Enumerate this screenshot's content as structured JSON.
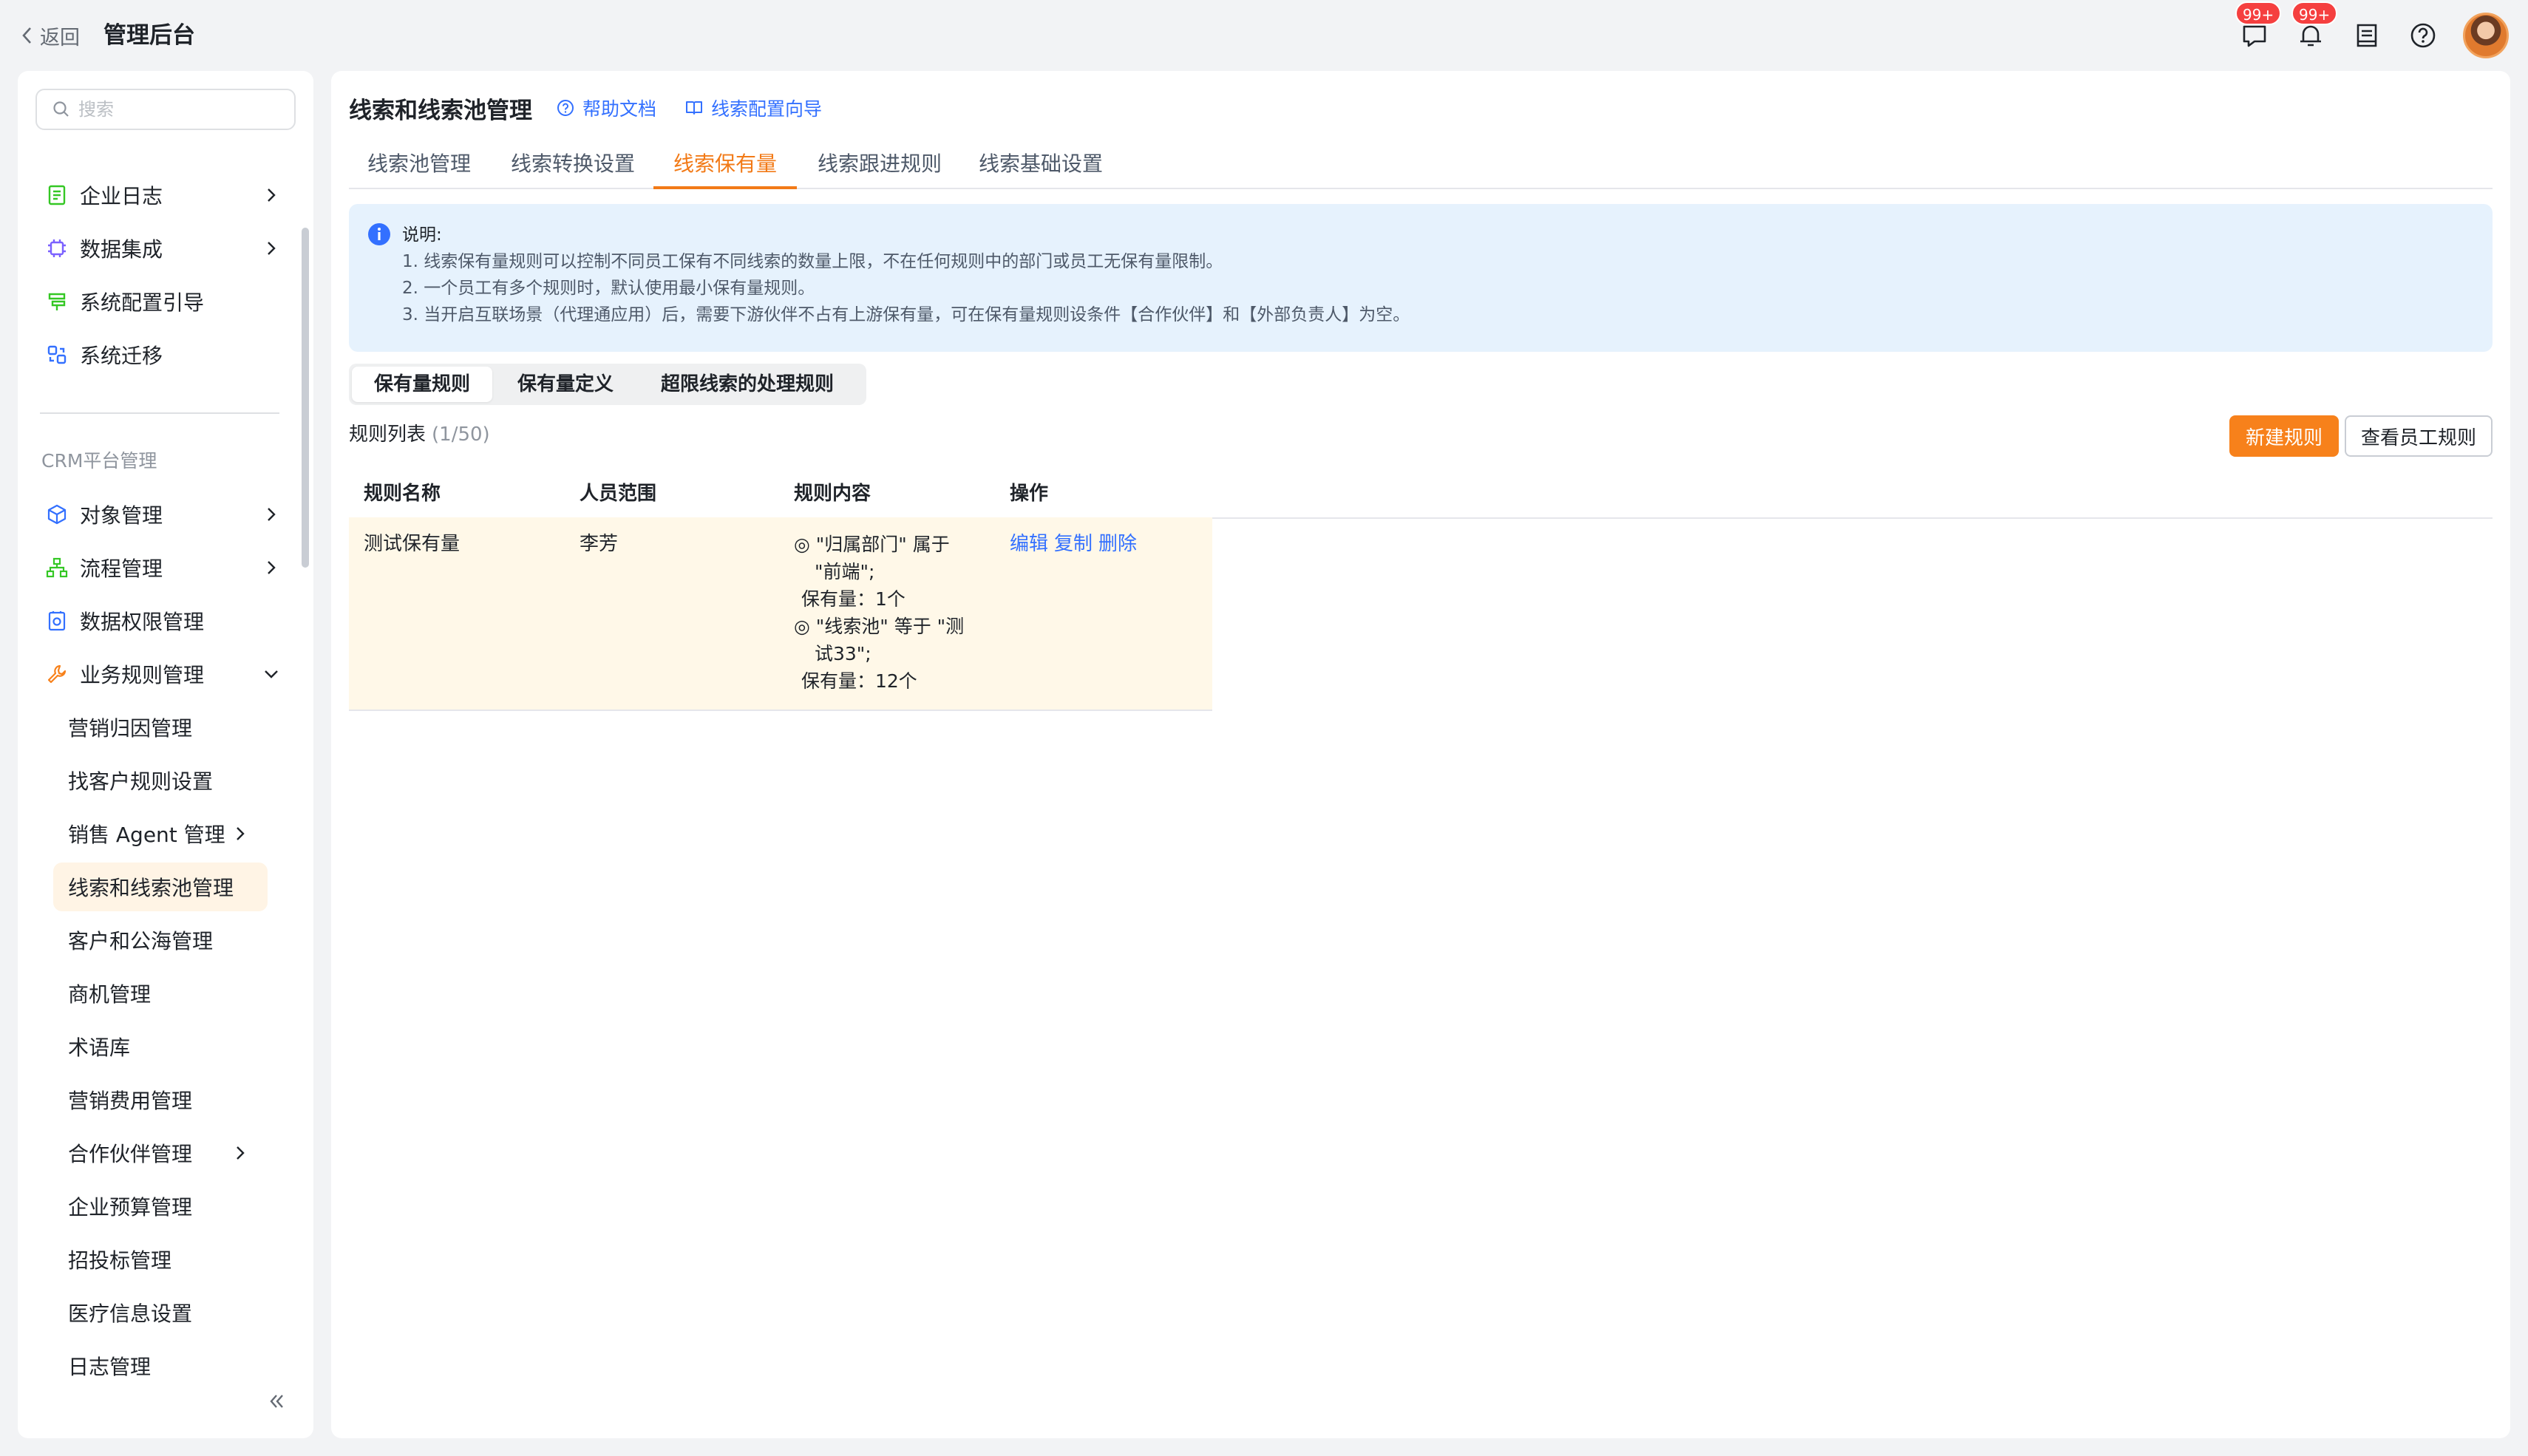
{
  "topbar": {
    "back_label": "返回",
    "app_title": "管理后台",
    "message_badge": "99+",
    "notification_badge": "99+"
  },
  "sidebar": {
    "search_placeholder": "搜索",
    "items_top": [
      {
        "label": "企业日志",
        "icon": "journal-icon",
        "has_children": true
      },
      {
        "label": "数据集成",
        "icon": "chip-icon",
        "has_children": true
      },
      {
        "label": "系统配置引导",
        "icon": "guide-icon",
        "has_children": false
      },
      {
        "label": "系统迁移",
        "icon": "migrate-icon",
        "has_children": false
      }
    ],
    "group_label": "CRM平台管理",
    "items_crm": [
      {
        "label": "对象管理",
        "icon": "cube-icon",
        "has_children": true
      },
      {
        "label": "流程管理",
        "icon": "flow-icon",
        "has_children": true
      },
      {
        "label": "数据权限管理",
        "icon": "data-permission-icon",
        "has_children": false
      },
      {
        "label": "业务规则管理",
        "icon": "wrench-icon",
        "has_children": true,
        "expanded": true
      }
    ],
    "sub_items": [
      {
        "label": "营销归因管理"
      },
      {
        "label": "找客户规则设置"
      },
      {
        "label": "销售 Agent 管理",
        "has_children": true
      },
      {
        "label": "线索和线索池管理",
        "active": true
      },
      {
        "label": "客户和公海管理"
      },
      {
        "label": "商机管理"
      },
      {
        "label": "术语库"
      },
      {
        "label": "营销费用管理"
      },
      {
        "label": "合作伙伴管理",
        "has_children": true
      },
      {
        "label": "企业预算管理"
      },
      {
        "label": "招投标管理"
      },
      {
        "label": "医疗信息设置"
      },
      {
        "label": "日志管理"
      }
    ]
  },
  "main": {
    "title": "线索和线索池管理",
    "help_link": "帮助文档",
    "guide_link": "线索配置向导",
    "tabs": [
      {
        "label": "线索池管理"
      },
      {
        "label": "线索转换设置"
      },
      {
        "label": "线索保有量",
        "active": true
      },
      {
        "label": "线索跟进规则"
      },
      {
        "label": "线索基础设置"
      }
    ],
    "notice": {
      "title": "说明:",
      "lines": [
        "1. 线索保有量规则可以控制不同员工保有不同线索的数量上限，不在任何规则中的部门或员工无保有量限制。",
        "2. 一个员工有多个规则时，默认使用最小保有量规则。",
        "3. 当开启互联场景（代理通应用）后，需要下游伙伴不占有上游保有量，可在保有量规则设条件【合作伙伴】和【外部负责人】为空。"
      ]
    },
    "segments": [
      {
        "label": "保有量规则",
        "active": true
      },
      {
        "label": "保有量定义"
      },
      {
        "label": "超限线索的处理规则"
      }
    ],
    "list_title": "规则列表",
    "list_count": "(1/50)",
    "new_rule_button": "新建规则",
    "view_employee_rules_button": "查看员工规则",
    "table": {
      "columns": [
        "规则名称",
        "人员范围",
        "规则内容",
        "操作"
      ],
      "rows": [
        {
          "name": "测试保有量",
          "scope": "李芳",
          "content": [
            "◎ \"归属部门\" 属于",
            "\"前端\";",
            "保有量：1个",
            "◎ \"线索池\" 等于 \"测",
            "试33\";",
            "保有量：12个"
          ],
          "actions": [
            "编辑",
            "复制",
            "删除"
          ]
        }
      ]
    }
  },
  "colors": {
    "accent": "#f7811b",
    "link": "#3370ff",
    "notice_bg": "#e6f2fd",
    "row_highlight": "#fff8e8",
    "badge": "#f53f3f"
  }
}
